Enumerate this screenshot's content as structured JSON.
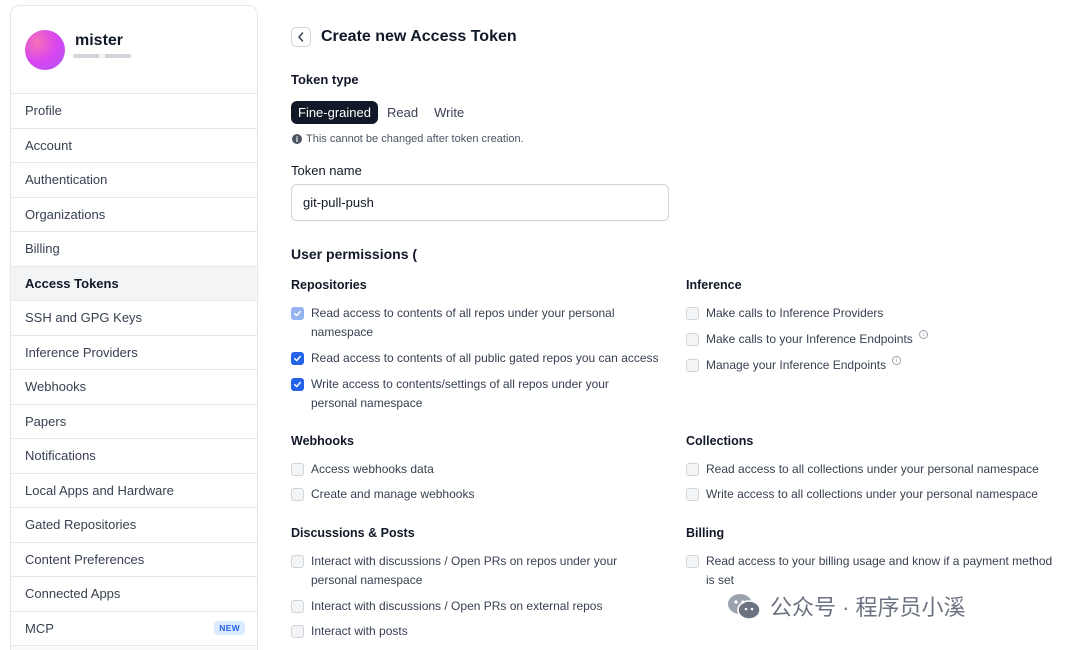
{
  "sidebar": {
    "username": "mister",
    "items": [
      {
        "label": "Profile"
      },
      {
        "label": "Account"
      },
      {
        "label": "Authentication"
      },
      {
        "label": "Organizations"
      },
      {
        "label": "Billing"
      },
      {
        "label": "Access Tokens"
      },
      {
        "label": "SSH and GPG Keys"
      },
      {
        "label": "Inference Providers"
      },
      {
        "label": "Webhooks"
      },
      {
        "label": "Papers"
      },
      {
        "label": "Notifications"
      },
      {
        "label": "Local Apps and Hardware"
      },
      {
        "label": "Gated Repositories"
      },
      {
        "label": "Content Preferences"
      },
      {
        "label": "Connected Apps"
      },
      {
        "label": "MCP",
        "badge": "NEW"
      }
    ],
    "active_item": "Access Tokens"
  },
  "main": {
    "title": "Create new Access Token",
    "back_icon": "chevron-left-icon",
    "token_type": {
      "label": "Token type",
      "options": [
        "Fine-grained",
        "Read",
        "Write"
      ],
      "selected": "Fine-grained",
      "hint": "This cannot be changed after token creation."
    },
    "token_name": {
      "label": "Token name",
      "value": "git-pull-push"
    },
    "permissions_title": "User permissions (",
    "sections": {
      "repositories": {
        "title": "Repositories",
        "items": [
          {
            "line1": "Read access to contents of all repos under your personal",
            "line2": "namespace",
            "checked": true,
            "state": "light"
          },
          {
            "line1": "Read access to contents of all public gated repos you can access",
            "line2": "",
            "checked": true,
            "state": "full"
          },
          {
            "line1": "Write access to contents/settings of all repos under your",
            "line2": "personal namespace",
            "checked": true,
            "state": "full"
          }
        ]
      },
      "inference": {
        "title": "Inference",
        "items": [
          {
            "line1": "Make calls to Inference Providers",
            "checked": false
          },
          {
            "line1": "Make calls to your Inference Endpoints",
            "checked": false,
            "info": true
          },
          {
            "line1": "Manage your Inference Endpoints",
            "checked": false,
            "info": true
          }
        ]
      },
      "webhooks": {
        "title": "Webhooks",
        "items": [
          {
            "line1": "Access webhooks data",
            "checked": false
          },
          {
            "line1": "Create and manage webhooks",
            "checked": false
          }
        ]
      },
      "collections": {
        "title": "Collections",
        "items": [
          {
            "line1": "Read access to all collections under your personal namespace",
            "checked": false
          },
          {
            "line1": "Write access to all collections under your personal namespace",
            "checked": false
          }
        ]
      },
      "discussions": {
        "title": "Discussions & Posts",
        "items": [
          {
            "line1": "Interact with discussions / Open PRs on repos under your",
            "line2": "personal namespace",
            "checked": false
          },
          {
            "line1": "Interact with discussions / Open PRs on external repos",
            "checked": false
          },
          {
            "line1": "Interact with posts",
            "checked": false
          }
        ]
      },
      "billing": {
        "title": "Billing",
        "items": [
          {
            "line1": "Read access to your billing usage and know if a payment method",
            "line2": "is set",
            "checked": false
          }
        ]
      }
    }
  },
  "watermark": {
    "text": "公众号 · 程序员小溪",
    "icon": "wechat-logo-icon"
  },
  "colors": {
    "accent": "#2563eb",
    "accent_light": "#93b4f0",
    "segment_active_bg": "#111827",
    "sidebar_active_bg": "#f3f4f6"
  }
}
